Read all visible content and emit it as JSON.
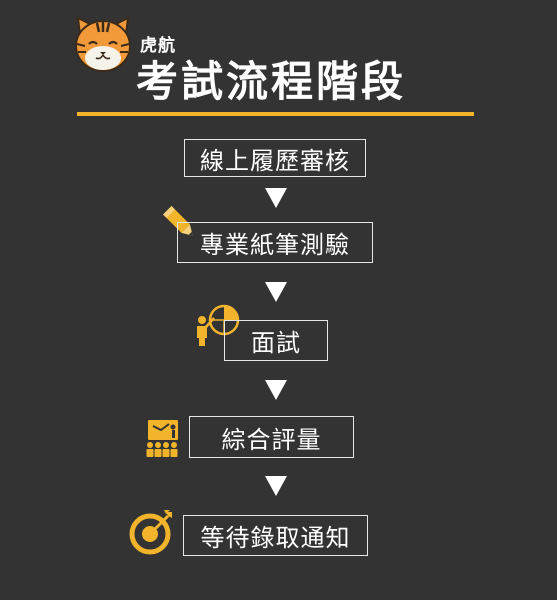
{
  "brand": {
    "name": "虎航"
  },
  "title": "考試流程階段",
  "colors": {
    "background": "#333333",
    "accent": "#f2b42a",
    "text": "#ffffff",
    "border": "#e6e6e6"
  },
  "steps": [
    {
      "label": "線上履歷審核",
      "icon": ""
    },
    {
      "label": "專業紙筆測驗",
      "icon": "pencil-icon"
    },
    {
      "label": "面試",
      "icon": "presenter-chart-icon"
    },
    {
      "label": "綜合評量",
      "icon": "audience-board-icon"
    },
    {
      "label": "等待錄取通知",
      "icon": "target-arrow-icon"
    }
  ],
  "arrow_glyph": "down-triangle-icon"
}
